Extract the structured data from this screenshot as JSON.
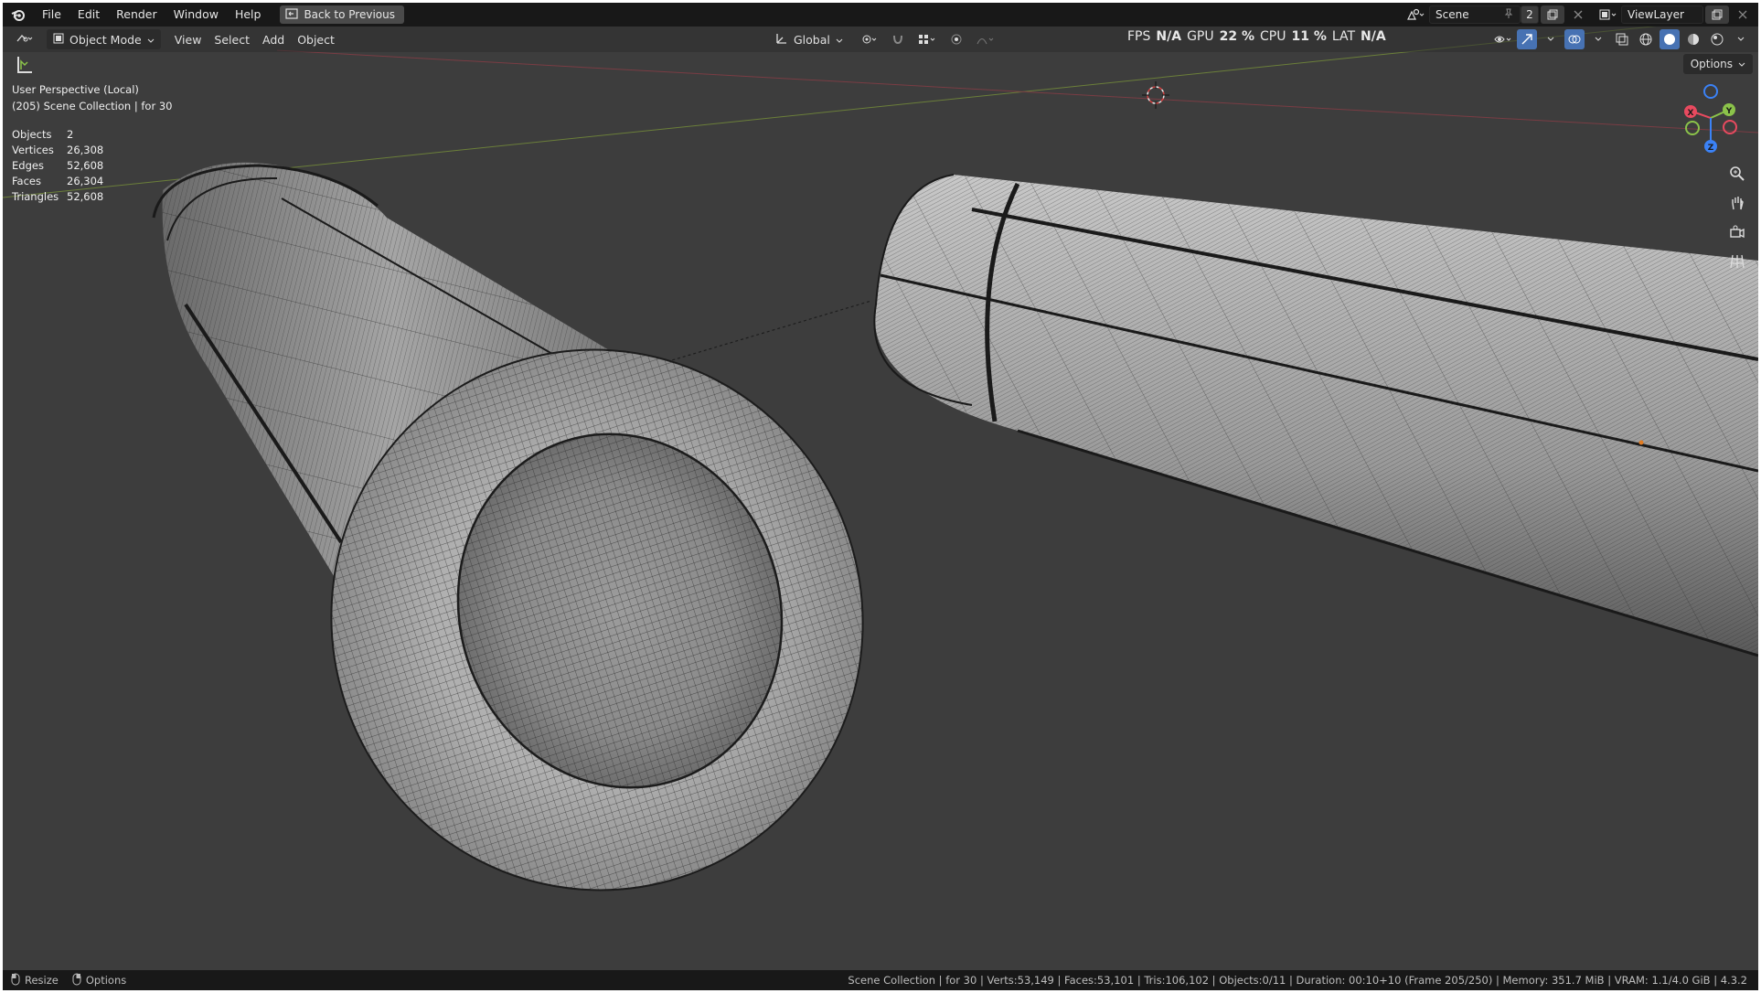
{
  "menu": {
    "file": "File",
    "edit": "Edit",
    "render": "Render",
    "window": "Window",
    "help": "Help",
    "back_to_previous": "Back to Previous"
  },
  "scene": {
    "scene_name": "Scene",
    "scene_count": "2",
    "view_layer": "ViewLayer"
  },
  "header": {
    "mode": "Object Mode",
    "view": "View",
    "select": "Select",
    "add": "Add",
    "object": "Object",
    "transform_orientation": "Global",
    "options": "Options"
  },
  "perf": {
    "fps_label": "FPS",
    "fps_value": "N/A",
    "gpu_label": "GPU",
    "gpu_value": "22 %",
    "cpu_label": "CPU",
    "cpu_value": "11 %",
    "lat_label": "LAT",
    "lat_value": "N/A"
  },
  "viewport_info": {
    "perspective": "User Perspective (Local)",
    "collection": "(205) Scene Collection | for 30"
  },
  "stats": [
    {
      "key": "Objects",
      "value": "2"
    },
    {
      "key": "Vertices",
      "value": "26,308"
    },
    {
      "key": "Edges",
      "value": "52,608"
    },
    {
      "key": "Faces",
      "value": "26,304"
    },
    {
      "key": "Triangles",
      "value": "52,608"
    }
  ],
  "gizmo": {
    "x": "X",
    "y": "Y",
    "z": "Z"
  },
  "statusbar": {
    "resize": "Resize",
    "options": "Options",
    "summary": "Scene Collection | for 30 | Verts:53,149 | Faces:53,101 | Tris:106,102 | Objects:0/11 | Duration: 00:10+10 (Frame 205/250) | Memory: 351.7 MiB | VRAM: 1.1/4.0 GiB | 4.3.2"
  },
  "colors": {
    "viewport_bg": "#3d3d3d",
    "axis_x": "#e84a5f",
    "axis_y": "#8bc34a",
    "axis_z": "#3b82f6",
    "accent": "#4772b3"
  }
}
